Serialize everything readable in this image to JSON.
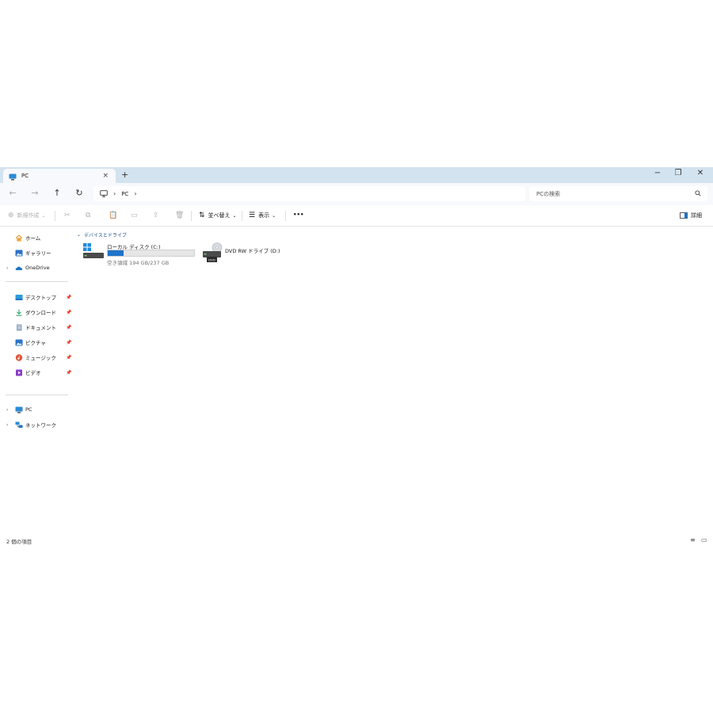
{
  "tab": {
    "title": "PC",
    "close": "×",
    "new": "+"
  },
  "window_controls": {
    "minimize": "−",
    "restore": "❐",
    "close": "✕"
  },
  "nav": {
    "back": "←",
    "forward": "→",
    "up": "↑",
    "refresh": "↻"
  },
  "address": {
    "segments": [
      "PC"
    ],
    "separator": "›"
  },
  "search": {
    "placeholder": "PCの検索"
  },
  "commands": {
    "new": "新規作成",
    "sort": "並べ替え",
    "view": "表示",
    "more": "•••",
    "details": "詳細"
  },
  "sidebar": {
    "top": [
      {
        "label": "ホーム",
        "icon": "home-icon"
      },
      {
        "label": "ギャラリー",
        "icon": "gallery-icon"
      },
      {
        "label": "OneDrive",
        "icon": "onedrive-icon"
      }
    ],
    "pinned": [
      {
        "label": "デスクトップ",
        "icon": "desktop-icon"
      },
      {
        "label": "ダウンロード",
        "icon": "download-icon"
      },
      {
        "label": "ドキュメント",
        "icon": "document-icon"
      },
      {
        "label": "ピクチャ",
        "icon": "pictures-icon"
      },
      {
        "label": "ミュージック",
        "icon": "music-icon"
      },
      {
        "label": "ビデオ",
        "icon": "video-icon"
      }
    ],
    "bottom": [
      {
        "label": "PC",
        "icon": "pc-icon"
      },
      {
        "label": "ネットワーク",
        "icon": "network-icon"
      }
    ]
  },
  "content": {
    "group_header": "デバイスとドライブ",
    "drives": [
      {
        "name": "ローカル ディスク (C:)",
        "free_text": "空き領域 194 GB/237 GB",
        "used_fraction": 0.18,
        "icon": "local-disk-icon"
      },
      {
        "name": "DVD RW ドライブ (D:)",
        "icon": "dvd-drive-icon"
      }
    ]
  },
  "status": {
    "item_count": "2 個の項目"
  },
  "colors": {
    "titlebar": "#d3e3ef",
    "accent": "#1f73c9",
    "group_header": "#1a4f8a"
  }
}
